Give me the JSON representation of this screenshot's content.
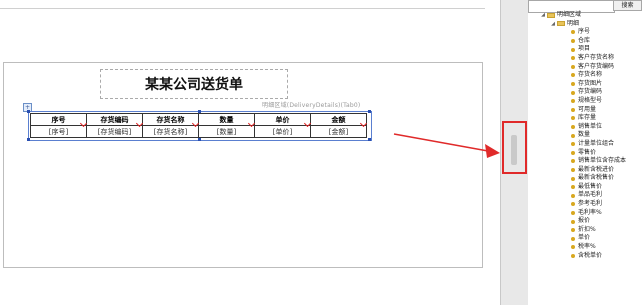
{
  "report": {
    "title": "某某公司送货单",
    "binding_label": "明细区域(DeliveryDetails)(Tab0)",
    "anchor_icon": "+",
    "table": {
      "headers": [
        "序号",
        "存货编码",
        "存货名称",
        "数量",
        "单价",
        "金额"
      ],
      "fields": [
        "[序号]",
        "[存货编码]",
        "[存货名称]",
        "[数量]",
        "[单价]",
        "[金额]"
      ]
    }
  },
  "search": {
    "placeholder": "",
    "button_label": "搜索"
  },
  "tree": {
    "root_label": "明细区域",
    "group_label": "明细",
    "expander": "◢",
    "fields": [
      "序号",
      "仓库",
      "项目",
      "客户存货名称",
      "客户存货编码",
      "存货名称",
      "存货图片",
      "存货编码",
      "规格型号",
      "可用量",
      "库存量",
      "销售单位",
      "数量",
      "计量单位组合",
      "零售价",
      "销售单位含存成本",
      "最新含税进价",
      "最新含税售价",
      "最低售价",
      "单品毛利",
      "参考毛利",
      "毛利率%",
      "报价",
      "折扣%",
      "单价",
      "税率%",
      "含税单价"
    ]
  },
  "annotation": {
    "color": "#e02a2a"
  }
}
